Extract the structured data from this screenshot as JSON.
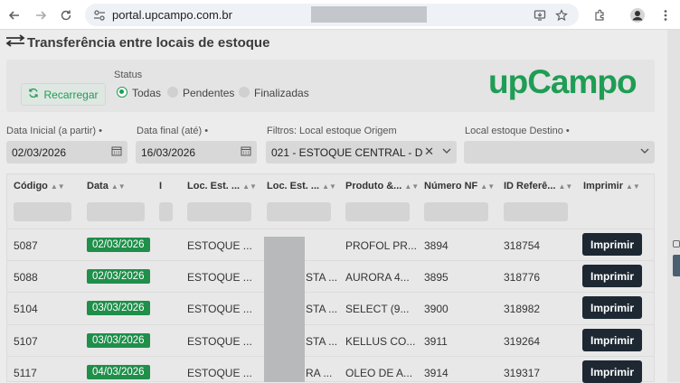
{
  "browser": {
    "url": "portal.upcampo.com.br"
  },
  "page": {
    "title": "Transferência entre locais de estoque"
  },
  "filters": {
    "reload_label": "Recarregar",
    "status_label": "Status",
    "status_options": [
      "Todas",
      "Pendentes",
      "Finalizadas"
    ],
    "status_selected": "Todas",
    "logo": "upCampo",
    "start_date_label": "Data Inicial (a partir) •",
    "start_date_value": "02/03/2026",
    "end_date_label": "Data final (até) •",
    "end_date_value": "16/03/2026",
    "origin_label": "Filtros: Local estoque Origem",
    "origin_value": "021 - ESTOQUE CENTRAL - DE",
    "dest_label": "Local estoque Destino •",
    "dest_value": ""
  },
  "table": {
    "headers": [
      "Código",
      "Data",
      "I",
      "Loc. Est. ...",
      "Loc. Est. ...",
      "Produto &...",
      "Número NF",
      "ID Referê...",
      "Imprimir"
    ],
    "print_label": "Imprimir",
    "rows": [
      {
        "codigo": "5087",
        "data": "02/03/2026",
        "loc1": "ESTOQUE ...",
        "loc2": "",
        "produto": "PROFOL PR...",
        "nf": "3894",
        "idref": "318754"
      },
      {
        "codigo": "5088",
        "data": "02/03/2026",
        "loc1": "ESTOQUE ...",
        "loc2": "STA ...",
        "produto": "AURORA 4...",
        "nf": "3895",
        "idref": "318776"
      },
      {
        "codigo": "5104",
        "data": "03/03/2026",
        "loc1": "ESTOQUE ...",
        "loc2": "STA ...",
        "produto": "SELECT (9...",
        "nf": "3900",
        "idref": "318982"
      },
      {
        "codigo": "5107",
        "data": "03/03/2026",
        "loc1": "ESTOQUE ...",
        "loc2": "STA ...",
        "produto": "KELLUS CO...",
        "nf": "3911",
        "idref": "319264"
      },
      {
        "codigo": "5117",
        "data": "04/03/2026",
        "loc1": "ESTOQUE ...",
        "loc2": "RA ...",
        "produto": "OLEO DE A...",
        "nf": "3914",
        "idref": "319317"
      }
    ]
  },
  "colors": {
    "brand": "#1f9d55",
    "badge": "#1f8f4a",
    "print_button": "#1d2833"
  }
}
